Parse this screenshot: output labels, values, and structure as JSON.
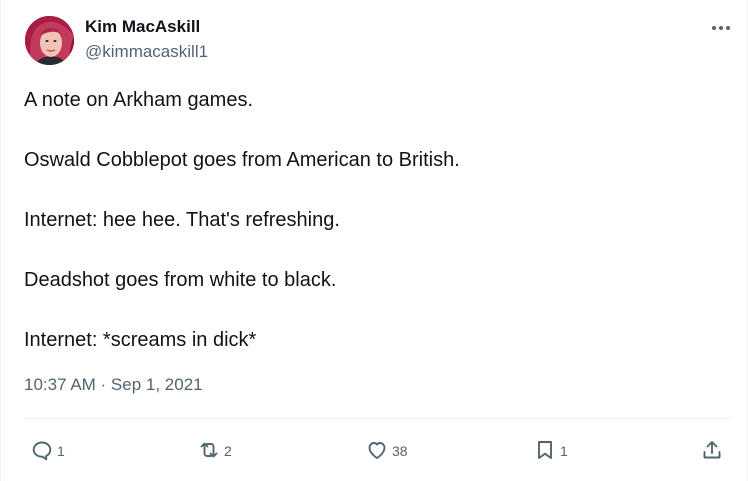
{
  "author": {
    "name": "Kim MacAskill",
    "handle": "@kimmacaskill1"
  },
  "tweet": {
    "lines": [
      "A note on Arkham games.",
      "Oswald Cobblepot goes from American to British.",
      "Internet: hee hee. That's refreshing.",
      "Deadshot goes from white to black.",
      "Internet: *screams in dick*"
    ],
    "timestamp": "10:37 AM · Sep 1, 2021"
  },
  "actions": {
    "replies": "1",
    "retweets": "2",
    "likes": "38",
    "bookmarks": "1"
  },
  "icons": [
    "more-icon",
    "reply-icon",
    "retweet-icon",
    "like-icon",
    "bookmark-icon",
    "share-icon"
  ]
}
